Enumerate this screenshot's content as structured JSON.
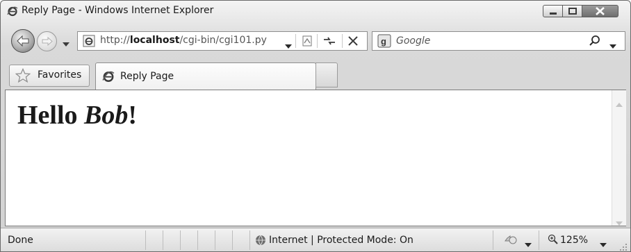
{
  "window": {
    "title": "Reply Page - Windows Internet Explorer"
  },
  "address_bar": {
    "url_prefix": "http://",
    "url_host": "localhost",
    "url_path": "/cgi-bin/cgi101.py"
  },
  "search": {
    "placeholder": "Google"
  },
  "favorites_bar": {
    "favorites_label": "Favorites"
  },
  "tabs": [
    {
      "label": "Reply Page",
      "active": true
    }
  ],
  "page": {
    "greeting": "Hello ",
    "name": "Bob",
    "punctuation": "!"
  },
  "status_bar": {
    "status": "Done",
    "zone": "Internet | Protected Mode: On",
    "zoom": "125%"
  },
  "icons": {
    "title": "ie-logo-icon",
    "back": "back-arrow-icon",
    "forward": "forward-arrow-icon",
    "page": "ie-page-icon",
    "compat": "compatibility-view-icon",
    "refresh": "refresh-icon",
    "stop": "stop-icon",
    "search_provider": "google-icon",
    "search": "magnifier-icon",
    "favorites": "star-icon",
    "zone": "globe-icon",
    "zoom": "zoom-magnifier-icon"
  },
  "colors": {
    "chrome": "#d2d2d2",
    "close_button": "#7a7a7a",
    "content_bg": "#ffffff",
    "text": "#1a1a1a"
  }
}
